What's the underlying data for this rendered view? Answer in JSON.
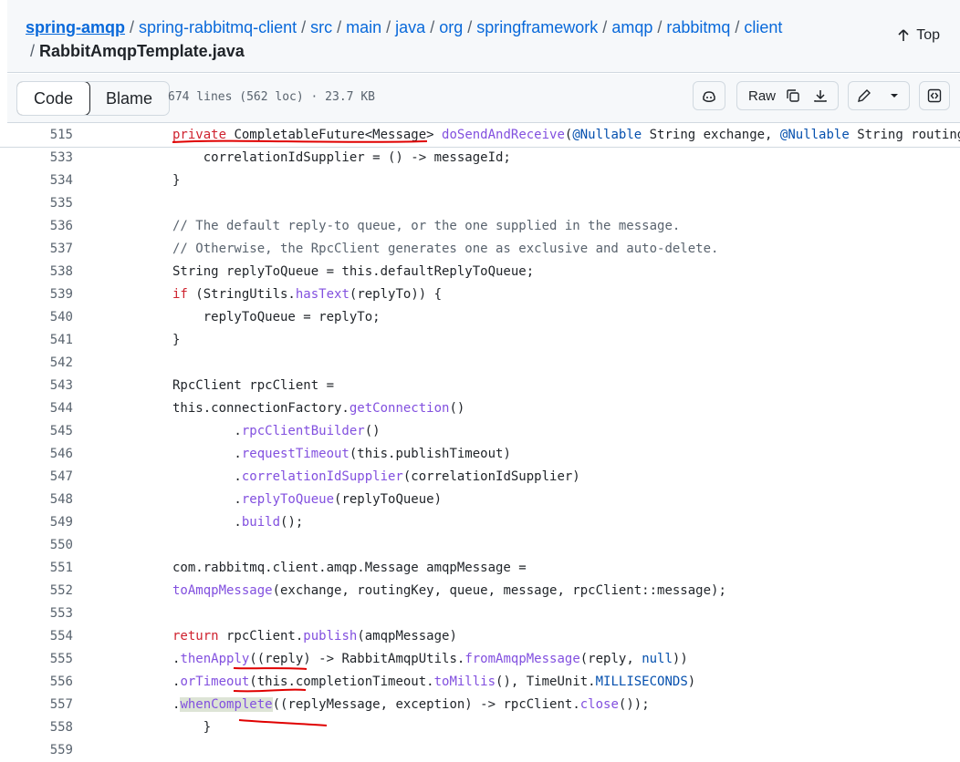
{
  "breadcrumb": {
    "repo": "spring-amqp",
    "path": [
      "spring-rabbitmq-client",
      "src",
      "main",
      "java",
      "org",
      "springframework",
      "amqp",
      "rabbitmq",
      "client"
    ],
    "file": "RabbitAmqpTemplate.java",
    "sep": "/"
  },
  "top_label": "Top",
  "toolbar": {
    "code_tab": "Code",
    "blame_tab": "Blame",
    "meta": "674 lines (562 loc) · 23.7 KB",
    "raw_label": "Raw"
  },
  "icons": [
    "copilot-icon",
    "copy-icon",
    "download-icon",
    "pencil-icon",
    "chevron-down-icon",
    "symbols-icon",
    "arrow-up-icon"
  ],
  "colors": {
    "keyword": "#cf222e",
    "function": "#8250df",
    "annotation": "#0550ae",
    "comment": "#59636e",
    "link": "#0969da",
    "pen": "#e00000"
  },
  "code": {
    "sticky": {
      "num": "515",
      "segs": [
        [
          "k",
          "private"
        ],
        [
          "",
          " CompletableFuture<Message> "
        ],
        [
          "f",
          "doSendAndReceive"
        ],
        [
          "",
          "("
        ],
        [
          "a",
          "@Nullable"
        ],
        [
          "",
          " String exchange, "
        ],
        [
          "a",
          "@Nullable"
        ],
        [
          "",
          " String routingKey"
        ]
      ]
    },
    "lines": [
      {
        "num": "533",
        "segs": [
          [
            "",
            "            correlationIdSupplier = () -> messageId;"
          ]
        ]
      },
      {
        "num": "534",
        "segs": [
          [
            "",
            "        }"
          ]
        ]
      },
      {
        "num": "535",
        "segs": []
      },
      {
        "num": "536",
        "segs": [
          [
            "c",
            "        // The default reply-to queue, or the one supplied in the message."
          ]
        ]
      },
      {
        "num": "537",
        "segs": [
          [
            "c",
            "        // Otherwise, the RpcClient generates one as exclusive and auto-delete."
          ]
        ]
      },
      {
        "num": "538",
        "segs": [
          [
            "",
            "        String replyToQueue = this.defaultReplyToQueue;"
          ]
        ]
      },
      {
        "num": "539",
        "segs": [
          [
            "k",
            "        if"
          ],
          [
            "",
            " (StringUtils."
          ],
          [
            "f",
            "hasText"
          ],
          [
            "",
            "(replyTo)) {"
          ]
        ]
      },
      {
        "num": "540",
        "segs": [
          [
            "",
            "            replyToQueue = replyTo;"
          ]
        ]
      },
      {
        "num": "541",
        "segs": [
          [
            "",
            "        }"
          ]
        ]
      },
      {
        "num": "542",
        "segs": []
      },
      {
        "num": "543",
        "segs": [
          [
            "",
            "        RpcClient rpcClient ="
          ]
        ]
      },
      {
        "num": "544",
        "segs": [
          [
            "",
            "                this.connectionFactory."
          ],
          [
            "f",
            "getConnection"
          ],
          [
            "",
            "()"
          ]
        ]
      },
      {
        "num": "545",
        "segs": [
          [
            "",
            "                        ."
          ],
          [
            "f",
            "rpcClientBuilder"
          ],
          [
            "",
            "()"
          ]
        ]
      },
      {
        "num": "546",
        "segs": [
          [
            "",
            "                        ."
          ],
          [
            "f",
            "requestTimeout"
          ],
          [
            "",
            "(this.publishTimeout)"
          ]
        ]
      },
      {
        "num": "547",
        "segs": [
          [
            "",
            "                        ."
          ],
          [
            "f",
            "correlationIdSupplier"
          ],
          [
            "",
            "(correlationIdSupplier)"
          ]
        ]
      },
      {
        "num": "548",
        "segs": [
          [
            "",
            "                        ."
          ],
          [
            "f",
            "replyToQueue"
          ],
          [
            "",
            "(replyToQueue)"
          ]
        ]
      },
      {
        "num": "549",
        "segs": [
          [
            "",
            "                        ."
          ],
          [
            "f",
            "build"
          ],
          [
            "",
            "();"
          ]
        ]
      },
      {
        "num": "550",
        "segs": []
      },
      {
        "num": "551",
        "segs": [
          [
            "",
            "        com.rabbitmq.client.amqp.Message amqpMessage ="
          ]
        ]
      },
      {
        "num": "552",
        "segs": [
          [
            "f",
            "                toAmqpMessage"
          ],
          [
            "",
            "(exchange, routingKey, queue, message, rpcClient::message);"
          ]
        ]
      },
      {
        "num": "553",
        "segs": []
      },
      {
        "num": "554",
        "segs": [
          [
            "k",
            "        return"
          ],
          [
            "",
            " rpcClient."
          ],
          [
            "f",
            "publish"
          ],
          [
            "",
            "(amqpMessage)"
          ]
        ]
      },
      {
        "num": "555",
        "segs": [
          [
            "",
            "                ."
          ],
          [
            "f",
            "thenApply"
          ],
          [
            "",
            "((reply) -> RabbitAmqpUtils."
          ],
          [
            "f",
            "fromAmqpMessage"
          ],
          [
            "",
            "(reply, "
          ],
          [
            "a",
            "null"
          ],
          [
            "",
            "))"
          ]
        ]
      },
      {
        "num": "556",
        "segs": [
          [
            "",
            "                ."
          ],
          [
            "f",
            "orTimeout"
          ],
          [
            "",
            "(this.completionTimeout."
          ],
          [
            "f",
            "toMillis"
          ],
          [
            "",
            "(), TimeUnit."
          ],
          [
            "a",
            "MILLISECONDS"
          ],
          [
            "",
            ")"
          ]
        ]
      },
      {
        "num": "557",
        "segs": [
          [
            "",
            "                ."
          ],
          [
            "fh",
            "whenComplete"
          ],
          [
            "",
            "((replyMessage, exception) -> rpcClient."
          ],
          [
            "f",
            "close"
          ],
          [
            "",
            "());"
          ]
        ]
      },
      {
        "num": "558",
        "segs": [
          [
            "",
            "    }"
          ]
        ]
      },
      {
        "num": "559",
        "segs": []
      }
    ]
  }
}
